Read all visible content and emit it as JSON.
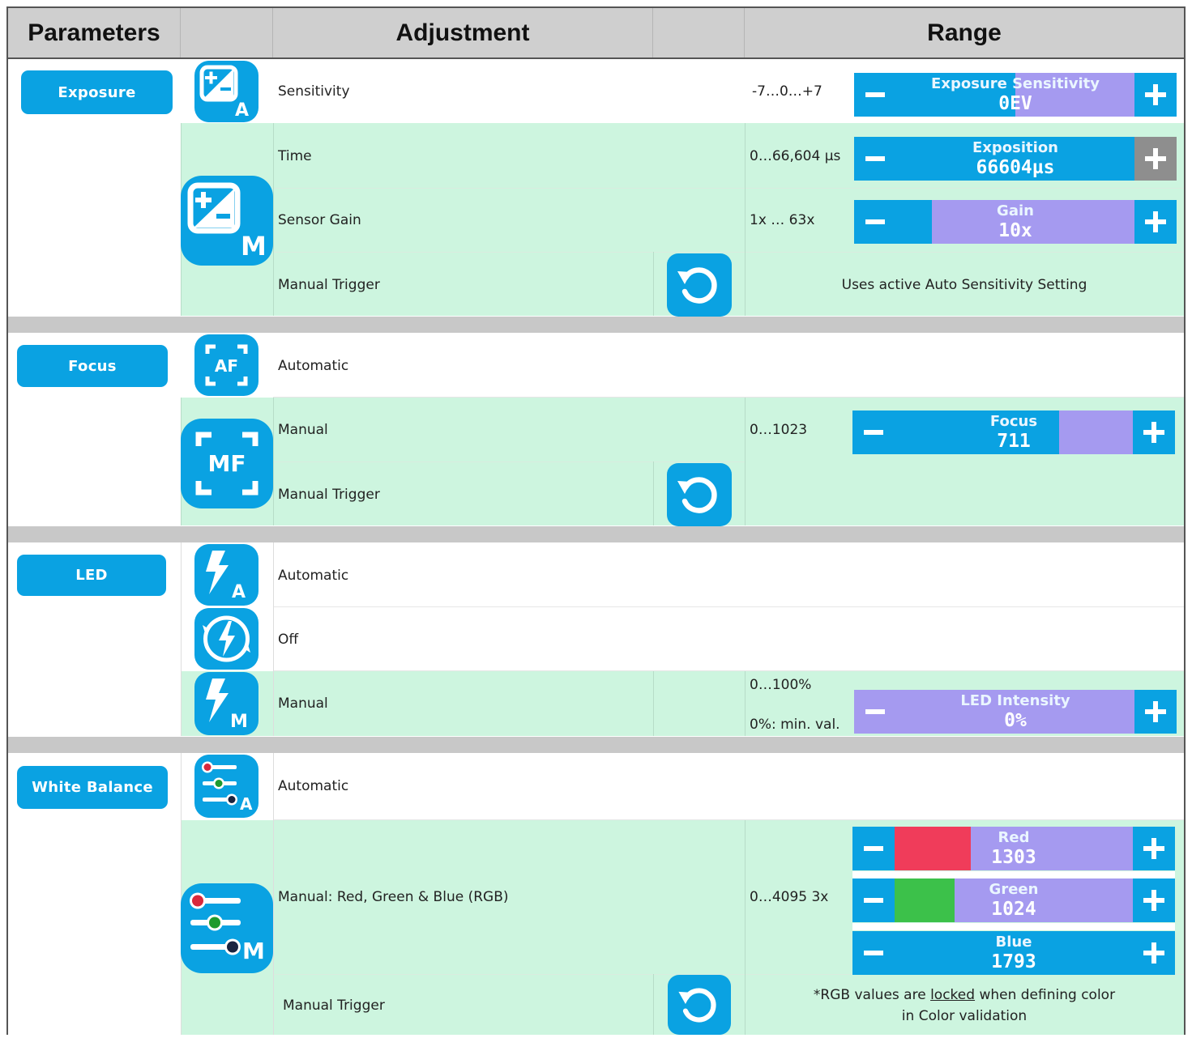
{
  "header": {
    "parameters": "Parameters",
    "adjustment": "Adjustment",
    "range": "Range"
  },
  "colors": {
    "accent": "#0aa2e2",
    "row_green": "#cdf5df",
    "track": "#a59af0",
    "separator": "#c8c8c8",
    "red": "#f03c5a",
    "green": "#3cc14a"
  },
  "sections": {
    "exposure": {
      "button": "Exposure",
      "rows": {
        "sensitivity": {
          "label": "Sensitivity",
          "range": "-7…0…+7",
          "slider_label": "Exposure Sensitivity",
          "slider_value": "0EV",
          "fill_percent": 50
        },
        "time": {
          "label": "Time",
          "range": "0…66,604 µs",
          "slider_label": "Exposition",
          "slider_value": "66604µs",
          "fill_percent": 100
        },
        "gain": {
          "label": "Sensor Gain",
          "range": "1x … 63x",
          "slider_label": "Gain",
          "slider_value": "10x",
          "fill_percent": 15
        },
        "trigger": {
          "label": "Manual Trigger",
          "note": "Uses active Auto Sensitivity Setting"
        }
      }
    },
    "focus": {
      "button": "Focus",
      "rows": {
        "automatic": {
          "label": "Automatic"
        },
        "manual": {
          "label": "Manual",
          "range": "0…1023",
          "slider_label": "Focus",
          "slider_value": "711",
          "fill_percent": 69
        },
        "trigger": {
          "label": "Manual Trigger"
        }
      }
    },
    "led": {
      "button": "LED",
      "rows": {
        "automatic": {
          "label": "Automatic"
        },
        "off": {
          "label": "Off"
        },
        "manual": {
          "label": "Manual",
          "range": "0…100%",
          "range_note": "0%: min. val.",
          "slider_label": "LED Intensity",
          "slider_value": "0%",
          "fill_percent": 0
        }
      }
    },
    "white_balance": {
      "button": "White Balance",
      "rows": {
        "automatic": {
          "label": "Automatic"
        },
        "manual": {
          "label": "Manual: Red, Green & Blue (RGB)",
          "range": "0…4095 3x",
          "red": {
            "label": "Red",
            "value": "1303",
            "fill_percent": 32
          },
          "green": {
            "label": "Green",
            "value": "1024",
            "fill_percent": 25
          },
          "blue": {
            "label": "Blue",
            "value": "1793",
            "fill_percent": 100
          }
        },
        "trigger": {
          "label": "Manual Trigger",
          "note_part1": "*RGB values are ",
          "note_locked": "locked",
          "note_part2": " when defining color",
          "note_line2": "in Color validation"
        }
      }
    }
  },
  "icons": {
    "exposure_auto": "exposure-compensation-auto-icon",
    "exposure_manual": "exposure-compensation-manual-icon",
    "af": "autofocus-icon",
    "mf": "manual-focus-icon",
    "led_auto": "flash-auto-icon",
    "led_off": "flash-off-icon",
    "led_manual": "flash-manual-icon",
    "wb_auto": "white-balance-auto-icon",
    "wb_manual": "white-balance-manual-icon",
    "trigger": "reset-trigger-icon",
    "minus": "minus-icon",
    "plus": "plus-icon"
  }
}
